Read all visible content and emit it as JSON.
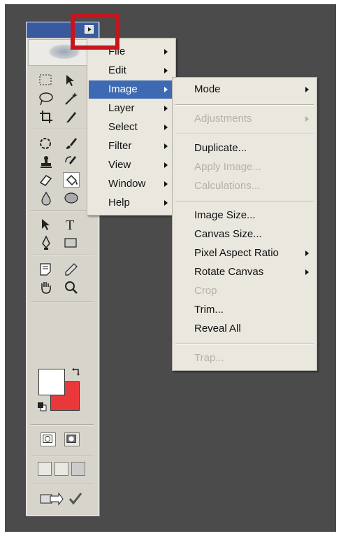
{
  "colors": {
    "background": "#4b4b4b",
    "title_bar": "#395a9e",
    "menu_bg": "#eae7df",
    "highlight": "#3e6ab3",
    "foreground_color": "#ffffff",
    "background_color": "#e8383a",
    "callout": "#c8141c"
  },
  "toolbox": {
    "tools": [
      "marquee-icon",
      "move-icon",
      "lasso-icon",
      "magic-wand-icon",
      "crop-icon",
      "slice-icon",
      "healing-brush-icon",
      "brush-icon",
      "clone-stamp-icon",
      "history-brush-icon",
      "eraser-icon",
      "paint-bucket-icon",
      "blur-icon",
      "dodge-icon",
      "path-selection-icon",
      "type-icon",
      "pen-icon",
      "rectangle-icon",
      "notes-icon",
      "eyedropper-icon",
      "hand-icon",
      "zoom-icon"
    ]
  },
  "main_menu": {
    "items": [
      {
        "label": "File",
        "submenu": true
      },
      {
        "label": "Edit",
        "submenu": true
      },
      {
        "label": "Image",
        "submenu": true,
        "active": true
      },
      {
        "label": "Layer",
        "submenu": true
      },
      {
        "label": "Select",
        "submenu": true
      },
      {
        "label": "Filter",
        "submenu": true
      },
      {
        "label": "View",
        "submenu": true
      },
      {
        "label": "Window",
        "submenu": true
      },
      {
        "label": "Help",
        "submenu": true
      }
    ]
  },
  "image_menu": {
    "mode": "Mode",
    "adjustments": "Adjustments",
    "duplicate": "Duplicate...",
    "apply_image": "Apply Image...",
    "calculations": "Calculations...",
    "image_size": "Image Size...",
    "canvas_size": "Canvas Size...",
    "pixel_aspect_ratio": "Pixel Aspect Ratio",
    "rotate_canvas": "Rotate Canvas",
    "crop": "Crop",
    "trim": "Trim...",
    "reveal_all": "Reveal All",
    "trap": "Trap..."
  }
}
